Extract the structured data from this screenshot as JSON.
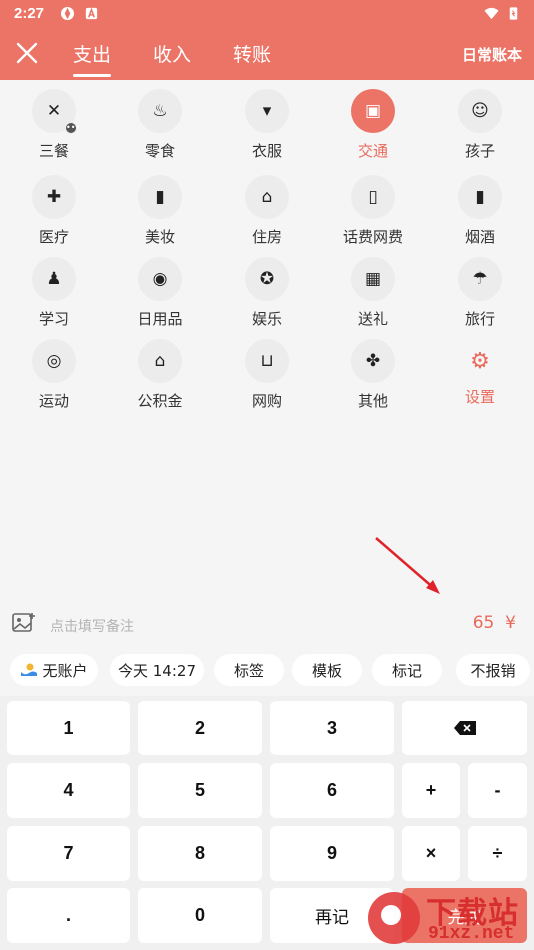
{
  "status": {
    "time": "2:27"
  },
  "header": {
    "tabs": [
      {
        "label": "支出",
        "active": true
      },
      {
        "label": "收入"
      },
      {
        "label": "转账"
      }
    ],
    "book": "日常账本"
  },
  "categories": [
    {
      "label": "三餐",
      "icon": "utensils-icon"
    },
    {
      "label": "零食",
      "icon": "cupcake-icon"
    },
    {
      "label": "衣服",
      "icon": "shirt-icon"
    },
    {
      "label": "交通",
      "icon": "bus-icon",
      "active": true
    },
    {
      "label": "孩子",
      "icon": "baby-icon"
    },
    {
      "label": "医疗",
      "icon": "medicine-icon"
    },
    {
      "label": "美妆",
      "icon": "lipstick-icon"
    },
    {
      "label": "住房",
      "icon": "house-icon"
    },
    {
      "label": "话费网费",
      "icon": "phone-icon"
    },
    {
      "label": "烟酒",
      "icon": "bottle-icon"
    },
    {
      "label": "学习",
      "icon": "student-icon"
    },
    {
      "label": "日用品",
      "icon": "tissue-icon"
    },
    {
      "label": "娱乐",
      "icon": "film-icon"
    },
    {
      "label": "送礼",
      "icon": "gift-icon"
    },
    {
      "label": "旅行",
      "icon": "palm-tree-icon"
    },
    {
      "label": "运动",
      "icon": "bicycle-icon"
    },
    {
      "label": "公积金",
      "icon": "fund-icon"
    },
    {
      "label": "网购",
      "icon": "cart-icon"
    },
    {
      "label": "其他",
      "icon": "grid-icon"
    },
    {
      "label": "设置",
      "icon": "gear-icon",
      "setting": true
    }
  ],
  "note": {
    "placeholder": "点击填写备注",
    "amount": "65",
    "currency": "¥"
  },
  "chips": {
    "account": "无账户",
    "date": "今天 14:27",
    "tag": "标签",
    "template": "模板",
    "mark": "标记",
    "noreimburse": "不报销"
  },
  "keypad": {
    "k1": "1",
    "k2": "2",
    "k3": "3",
    "k4": "4",
    "k5": "5",
    "k6": "6",
    "plus": "+",
    "minus": "-",
    "k7": "7",
    "k8": "8",
    "k9": "9",
    "times": "×",
    "divide": "÷",
    "dot": ".",
    "k0": "0",
    "again": "再记",
    "done": "完成"
  },
  "watermark": {
    "title": "下载站",
    "domain": "91xz.net"
  },
  "colors": {
    "accent": "#eb7466",
    "accent_text": "#e86a5c",
    "background": "#f5f5f5"
  }
}
